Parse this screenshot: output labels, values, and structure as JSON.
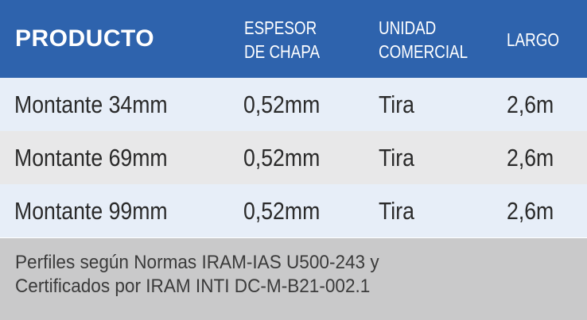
{
  "header": {
    "producto": "PRODUCTO",
    "espesor_line1": "ESPESOR",
    "espesor_line2": "DE CHAPA",
    "unidad_line1": "UNIDAD",
    "unidad_line2": "COMERCIAL",
    "largo": "LARGO"
  },
  "rows": [
    {
      "producto": "Montante 34mm",
      "espesor": "0,52mm",
      "unidad": "Tira",
      "largo": "2,6m"
    },
    {
      "producto": "Montante 69mm",
      "espesor": "0,52mm",
      "unidad": "Tira",
      "largo": "2,6m"
    },
    {
      "producto": "Montante 99mm",
      "espesor": "0,52mm",
      "unidad": "Tira",
      "largo": "2,6m"
    }
  ],
  "footer": {
    "line1": "Perfiles según Normas IRAM-IAS U500-243 y",
    "line2": "Certificados por IRAM INTI DC-M-B21-002.1"
  },
  "colors": {
    "header_bg": "#2e63ad",
    "row_light": "#e7eef8",
    "row_gray": "#e8e8e9",
    "footer_bg": "#c9c9ca"
  }
}
